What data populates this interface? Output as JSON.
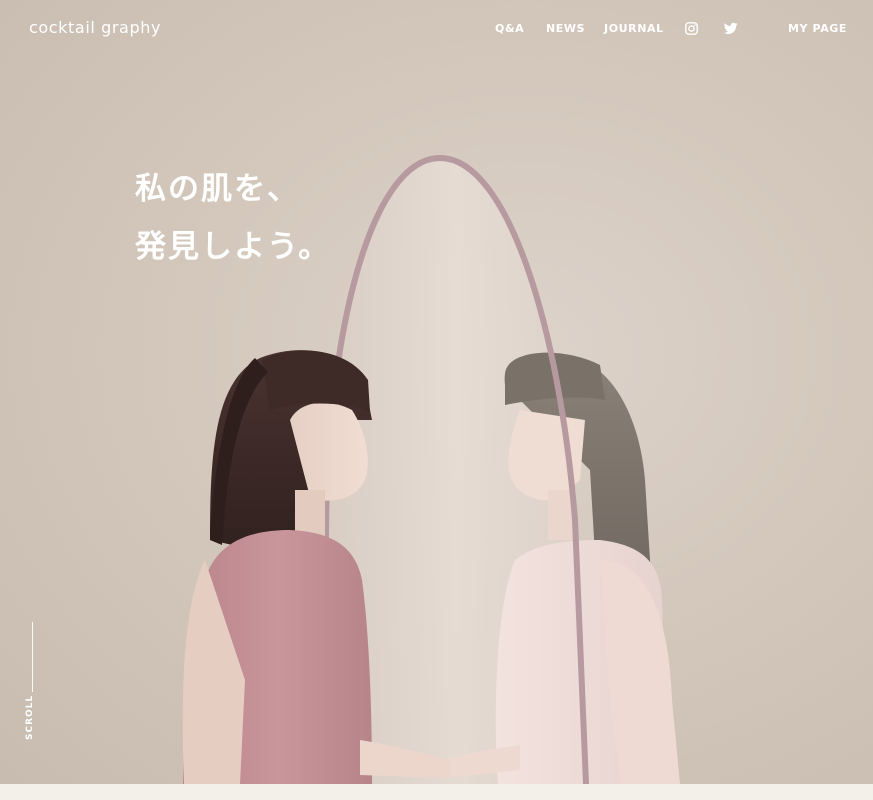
{
  "header": {
    "logo": "cocktail graphy",
    "nav": {
      "qa": "Q&A",
      "news": "NEWS",
      "journal": "JOURNAL",
      "instagram_icon": "instagram-icon",
      "twitter_icon": "twitter-icon",
      "mypage": "MY PAGE"
    }
  },
  "hero": {
    "headline_line1": "私の肌を、",
    "headline_line2": "発見しよう。",
    "scroll_label": "SCROLL"
  },
  "colors": {
    "background": "#d4c8bd",
    "text": "#ffffff",
    "bottom_band": "#f3efe9",
    "left_dress": "#c48f95",
    "right_dress": "#efdcd8",
    "left_hair": "#3e2a27",
    "right_hair": "#7d746c",
    "mirror_frame": "#b79aa0"
  }
}
